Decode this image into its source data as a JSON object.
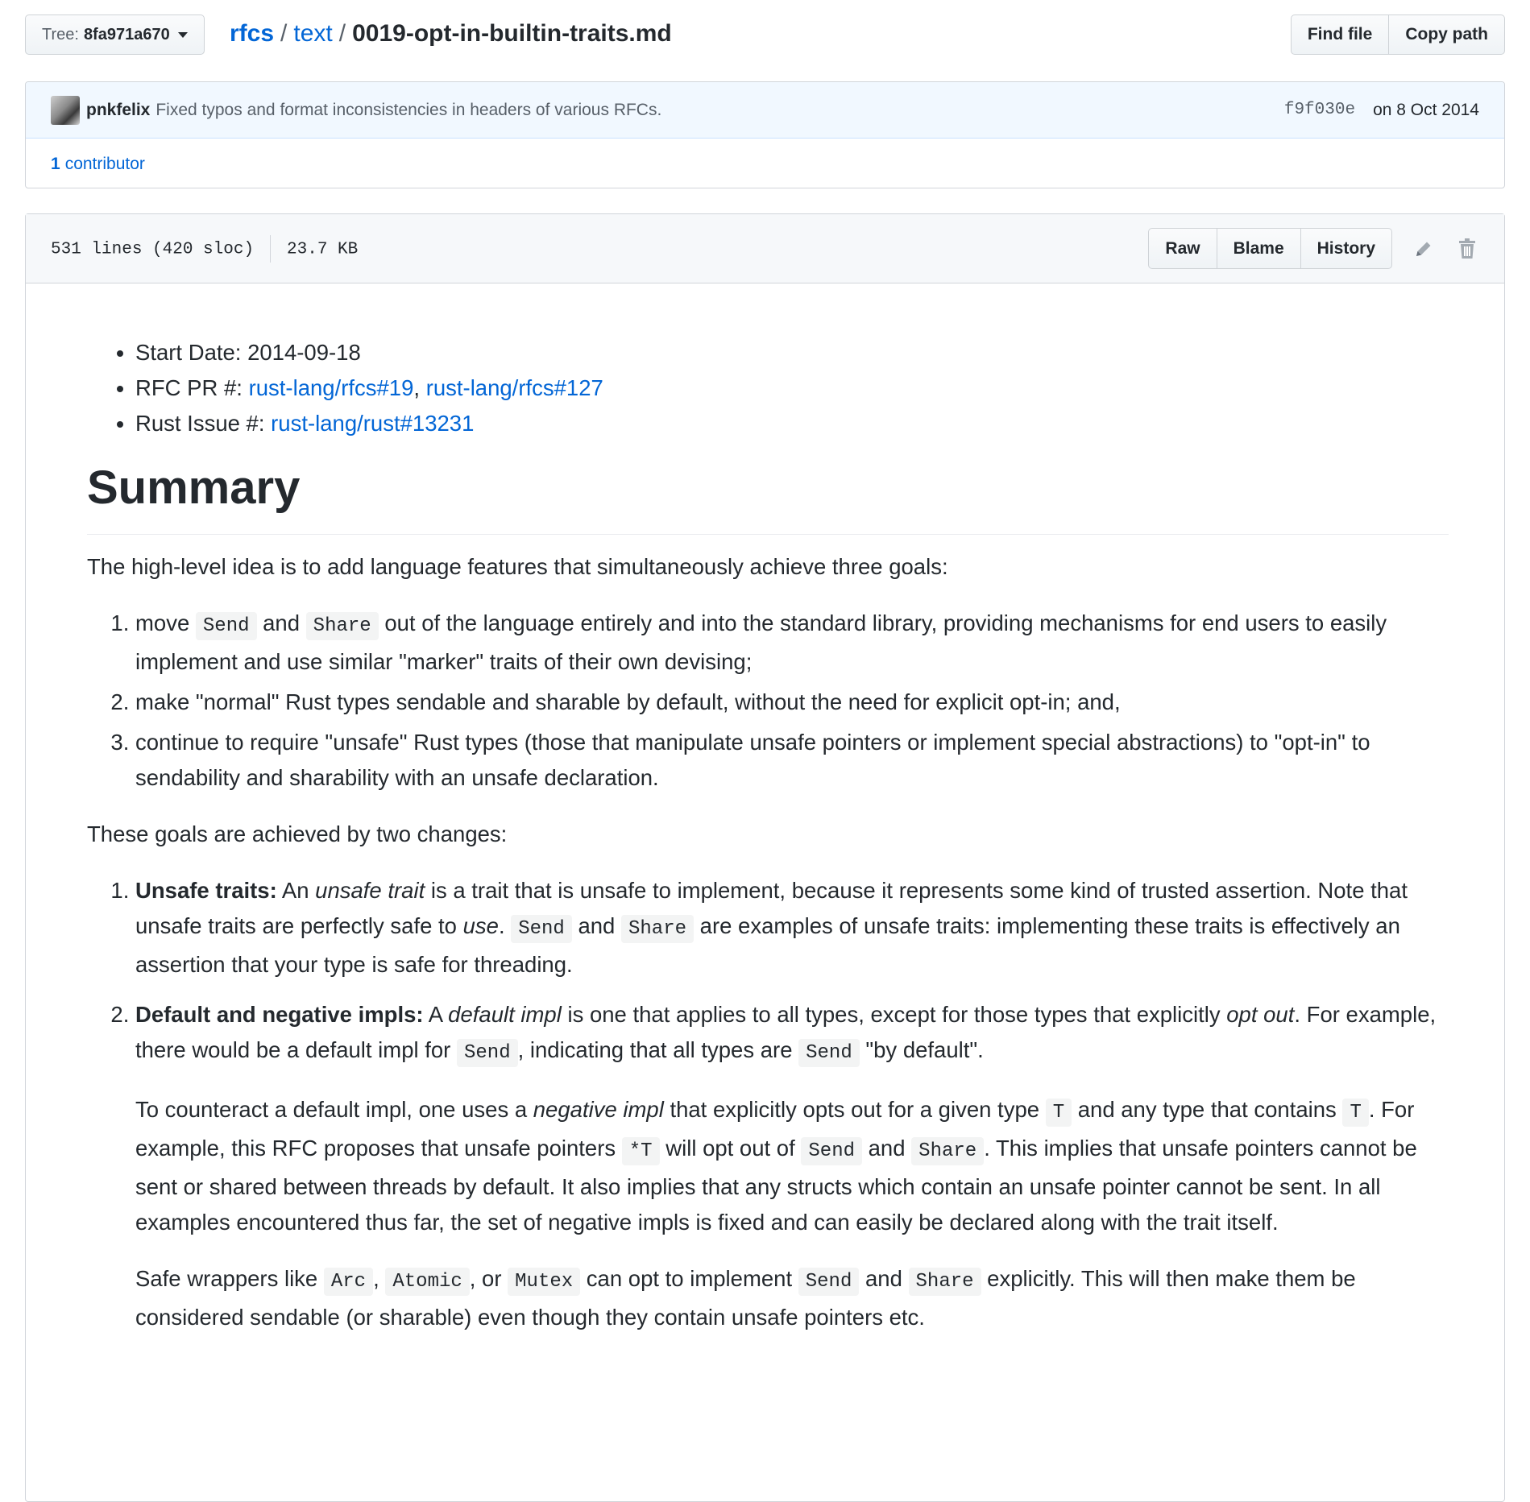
{
  "path_bar": {
    "tree_label": "Tree:",
    "tree_value": "8fa971a670",
    "breadcrumb": [
      "rfcs",
      "text"
    ],
    "separator": "/",
    "filename": "0019-opt-in-builtin-traits.md",
    "find_file": "Find file",
    "copy_path": "Copy path"
  },
  "commit": {
    "author": "pnkfelix",
    "message": "Fixed typos and format inconsistencies in headers of various RFCs.",
    "sha": "f9f030e",
    "date": "on 8 Oct 2014",
    "contributors_count": "1",
    "contributors_label": "contributor"
  },
  "file": {
    "lines": "531 lines (420 sloc)",
    "size": "23.7 KB",
    "raw": "Raw",
    "blame": "Blame",
    "history": "History"
  },
  "content": {
    "meta": {
      "start_date": "Start Date: 2014-09-18",
      "rfc_pr_label": "RFC PR #: ",
      "rfc_pr_link1": "rust-lang/rfcs#19",
      "comma": ", ",
      "rfc_pr_link2": "rust-lang/rfcs#127",
      "issue_label": "Rust Issue #: ",
      "issue_link": "rust-lang/rust#13231"
    },
    "summary_heading": "Summary",
    "intro": "The high-level idea is to add language features that simultaneously achieve three goals:",
    "goals": {
      "g1_a": "move ",
      "g1_code1": "Send",
      "g1_b": " and ",
      "g1_code2": "Share",
      "g1_c": " out of the language entirely and into the standard library, providing mechanisms for end users to easily implement and use similar \"marker\" traits of their own devising;",
      "g2": "make \"normal\" Rust types sendable and sharable by default, without the need for explicit opt-in; and,",
      "g3": "continue to require \"unsafe\" Rust types (those that manipulate unsafe pointers or implement special abstractions) to \"opt-in\" to sendability and sharability with an unsafe declaration."
    },
    "changes_intro": "These goals are achieved by two changes:",
    "change1": {
      "bold": "Unsafe traits:",
      "a": " An ",
      "em1": "unsafe trait",
      "b": " is a trait that is unsafe to implement, because it represents some kind of trusted assertion. Note that unsafe traits are perfectly safe to ",
      "em2": "use",
      "c": ". ",
      "code1": "Send",
      "d": " and ",
      "code2": "Share",
      "e": " are examples of unsafe traits: implementing these traits is effectively an assertion that your type is safe for threading."
    },
    "change2": {
      "bold": "Default and negative impls:",
      "a": " A ",
      "em1": "default impl",
      "b": " is one that applies to all types, except for those types that explicitly ",
      "em2": "opt out",
      "c": ". For example, there would be a default impl for ",
      "code1": "Send",
      "d": ", indicating that all types are ",
      "code2": "Send",
      "e": " \"by default\".",
      "p2_a": "To counteract a default impl, one uses a ",
      "p2_em": "negative impl",
      "p2_b": " that explicitly opts out for a given type ",
      "p2_code1": "T",
      "p2_c": " and any type that contains ",
      "p2_code2": "T",
      "p2_d": ". For example, this RFC proposes that unsafe pointers ",
      "p2_code3": "*T",
      "p2_e": " will opt out of ",
      "p2_code4": "Send",
      "p2_f": " and ",
      "p2_code5": "Share",
      "p2_g": ". This implies that unsafe pointers cannot be sent or shared between threads by default. It also implies that any structs which contain an unsafe pointer cannot be sent. In all examples encountered thus far, the set of negative impls is fixed and can easily be declared along with the trait itself.",
      "p3_a": "Safe wrappers like ",
      "p3_code1": "Arc",
      "p3_b": ", ",
      "p3_code2": "Atomic",
      "p3_c": ", or ",
      "p3_code3": "Mutex",
      "p3_d": " can opt to implement ",
      "p3_code4": "Send",
      "p3_e": " and ",
      "p3_code5": "Share",
      "p3_f": " explicitly. This will then make them be considered sendable (or sharable) even though they contain unsafe pointers etc."
    }
  }
}
